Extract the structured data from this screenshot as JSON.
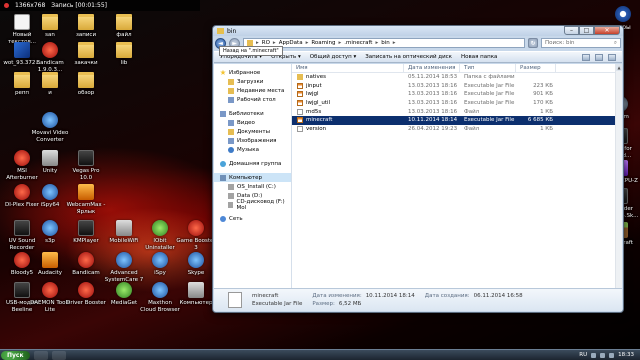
{
  "recording_bar": {
    "size": "1366x768",
    "label": "Запись [00:01:55]"
  },
  "desktop_icons": [
    {
      "label": "Новый текстов...",
      "kind": "doc"
    },
    {
      "label": "san",
      "kind": "folder"
    },
    {
      "label": "записи",
      "kind": "folder"
    },
    {
      "label": "файл",
      "kind": "folder"
    },
    {
      "label": "wot_93.372...",
      "kind": "app"
    },
    {
      "label": "Bandicam 1.9.0.3...",
      "kind": "red"
    },
    {
      "label": "закачки",
      "kind": "folder"
    },
    {
      "label": "lib",
      "kind": "folder"
    },
    {
      "label": "репп",
      "kind": "folder"
    },
    {
      "label": "и",
      "kind": "folder"
    },
    {
      "label": "обзор",
      "kind": "folder"
    },
    {
      "label": "Movavi Video Converter",
      "kind": "blue"
    },
    {
      "label": "MSI Afterburner",
      "kind": "red"
    },
    {
      "label": "Unity",
      "kind": "grey"
    },
    {
      "label": "Vegas Pro 10.0",
      "kind": "dark"
    },
    {
      "label": "DI-Plex Fixer",
      "kind": "red"
    },
    {
      "label": "iSpy64",
      "kind": "blue"
    },
    {
      "label": "WebcamMax - Ярлык",
      "kind": "orange"
    },
    {
      "label": "UV Sound Recorder",
      "kind": "dark"
    },
    {
      "label": "s3p",
      "kind": "blue"
    },
    {
      "label": "KMPlayer",
      "kind": "dark"
    },
    {
      "label": "MobileWiFi",
      "kind": "grey"
    },
    {
      "label": "IObit Uninstaller",
      "kind": "green"
    },
    {
      "label": "Game Booster 3",
      "kind": "red"
    },
    {
      "label": "Bloody5",
      "kind": "red"
    },
    {
      "label": "Audacity",
      "kind": "orange"
    },
    {
      "label": "Bandicam",
      "kind": "red"
    },
    {
      "label": "Advanced SystemCare 7",
      "kind": "blue"
    },
    {
      "label": "iSpy",
      "kind": "blue"
    },
    {
      "label": "Skype",
      "kind": "blue"
    },
    {
      "label": "USB-модем Beeline",
      "kind": "dark"
    },
    {
      "label": "DAEMON Tools Lite",
      "kind": "red"
    },
    {
      "label": "Driver Booster",
      "kind": "red"
    },
    {
      "label": "MediaGet",
      "kind": "green"
    },
    {
      "label": "Maxthon Cloud Browser",
      "kind": "blue"
    },
    {
      "label": "Компьютер",
      "kind": "grey"
    },
    {
      "label": "Корзина",
      "kind": "grey"
    },
    {
      "label": "Yahcam",
      "kind": "purple"
    },
    {
      "label": "Switch to Gaming Mode",
      "kind": "green"
    },
    {
      "label": "Steam",
      "kind": "steam"
    },
    {
      "label": "Need for Speed...",
      "kind": "dark"
    },
    {
      "label": "CPUID CPU-Z",
      "kind": "purple"
    },
    {
      "label": "The Elder Scrolls 5.Sk...",
      "kind": "dark"
    },
    {
      "label": "Minecraft",
      "kind": "mc"
    }
  ],
  "games_widget": {
    "label": "игры"
  },
  "window": {
    "title": "bin",
    "nav": {
      "back_glyph": "◄",
      "forward_glyph": "►"
    },
    "tooltip": "Назад на \".minecraft\"",
    "breadcrumb": [
      "RO",
      "AppData",
      "Roaming",
      ".minecraft",
      "bin"
    ],
    "search_placeholder": "Поиск: bin",
    "toolbar": [
      "Упорядочить ▾",
      "Открыть ▾",
      "Общий доступ ▾",
      "Записать на оптический диск",
      "Новая папка"
    ],
    "navpane": {
      "favorites": {
        "label": "Избранное",
        "items": [
          "Загрузки",
          "Недавние места",
          "Рабочий стол"
        ]
      },
      "libraries": {
        "label": "Библиотеки",
        "items": [
          "Видео",
          "Документы",
          "Изображения",
          "Музыка"
        ]
      },
      "homegroup": "Домашняя группа",
      "computer": {
        "label": "Компьютер",
        "items": [
          "OS_Install (C:)",
          "Data (D:)",
          "CD-дисковод (F:) Mol"
        ]
      },
      "network": "Сеть"
    },
    "columns": {
      "name": "Имя",
      "date": "Дата изменения",
      "type": "Тип",
      "size": "Размер"
    },
    "files": [
      {
        "name": "natives",
        "icon": "folder",
        "date": "05.11.2014 18:53",
        "type": "Папка с файлами",
        "size": ""
      },
      {
        "name": "jinput",
        "icon": "jar",
        "date": "13.03.2013 18:16",
        "type": "Executable Jar File",
        "size": "223 КБ"
      },
      {
        "name": "lwjgl",
        "icon": "jar",
        "date": "13.03.2013 18:16",
        "type": "Executable Jar File",
        "size": "901 КБ"
      },
      {
        "name": "lwjgl_util",
        "icon": "jar",
        "date": "13.03.2013 18:16",
        "type": "Executable Jar File",
        "size": "170 КБ"
      },
      {
        "name": "md5s",
        "icon": "file",
        "date": "13.03.2013 18:16",
        "type": "Файл",
        "size": "1 КБ"
      },
      {
        "name": "minecraft",
        "icon": "jar",
        "date": "10.11.2014 18:14",
        "type": "Executable Jar File",
        "size": "6 685 КБ",
        "selected": true
      },
      {
        "name": "version",
        "icon": "file",
        "date": "26.04.2012 19:23",
        "type": "Файл",
        "size": "1 КБ"
      }
    ],
    "details": {
      "name": "minecraft",
      "type": "Executable Jar File",
      "modified_label": "Дата изменения:",
      "modified": "10.11.2014 18:14",
      "created_label": "Дата создания:",
      "created": "06.11.2014 16:58",
      "size_label": "Размер:",
      "size": "6,52 МБ"
    }
  },
  "taskbar": {
    "start": "Пуск",
    "lang": "RU",
    "time": "18:33"
  }
}
